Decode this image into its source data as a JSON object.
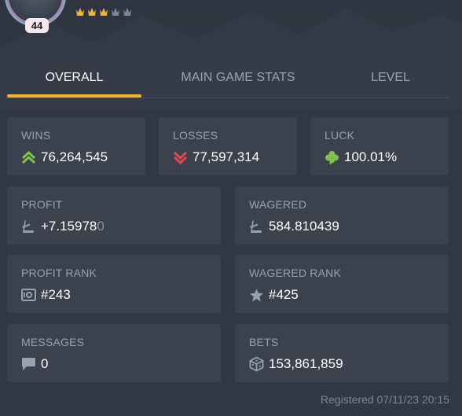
{
  "profile": {
    "level": "44",
    "crowns_filled": 3,
    "crowns_total": 5
  },
  "tabs": [
    {
      "label": "OVERALL",
      "active": true
    },
    {
      "label": "MAIN GAME STATS",
      "active": false
    },
    {
      "label": "LEVEL",
      "active": false
    }
  ],
  "stats": {
    "wins": {
      "label": "WINS",
      "value": "76,264,545",
      "icon": "chevrons-up-icon"
    },
    "losses": {
      "label": "LOSSES",
      "value": "77,597,314",
      "icon": "chevrons-down-icon"
    },
    "luck": {
      "label": "LUCK",
      "value": "100.01%",
      "icon": "clover-icon"
    },
    "profit": {
      "label": "PROFIT",
      "value_main": "+7.15978",
      "value_dim": "0",
      "icon": "litecoin-icon"
    },
    "wagered": {
      "label": "WAGERED",
      "value": "584.810439",
      "icon": "litecoin-icon"
    },
    "profit_rank": {
      "label": "PROFIT RANK",
      "value": "#243",
      "icon": "safe-icon"
    },
    "wagered_rank": {
      "label": "WAGERED RANK",
      "value": "#425",
      "icon": "star-icon"
    },
    "messages": {
      "label": "MESSAGES",
      "value": "0",
      "icon": "chat-icon"
    },
    "bets": {
      "label": "BETS",
      "value": "153,861,859",
      "icon": "dice-icon"
    }
  },
  "registered": "Registered 07/11/23 20:15",
  "colors": {
    "background": "#313843",
    "card": "#3b424d",
    "accent_tab": "#f3b72b",
    "win_green": "#7ec24a",
    "loss_red": "#e0484b",
    "crown_gold": "#f3b72b",
    "crown_grey": "#7d8794"
  }
}
